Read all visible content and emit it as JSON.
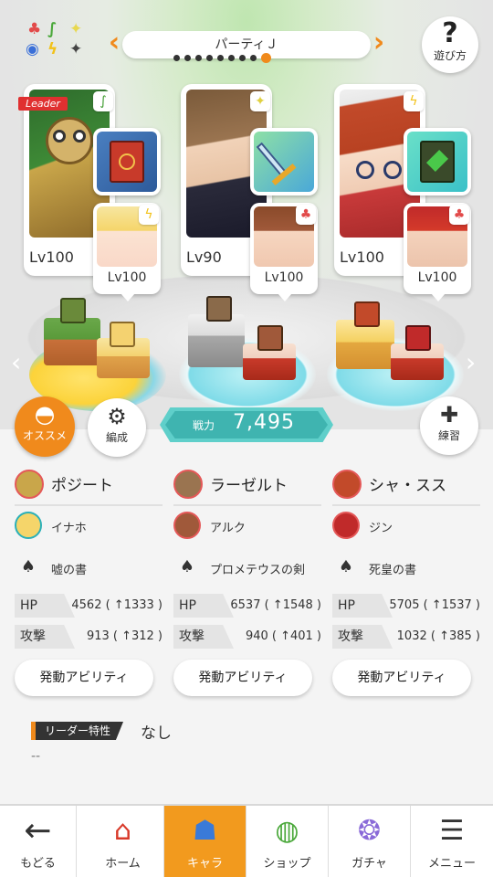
{
  "header": {
    "party_name": "パーティＪ",
    "help_label": "遊び方",
    "page_total": 9,
    "page_active": 9
  },
  "attributes_legend": [
    "fire",
    "nature",
    "light",
    "water",
    "thunder",
    "dark"
  ],
  "cards": [
    {
      "leader_tag": "Leader",
      "main_level": "Lv100",
      "sub_level": "Lv100",
      "attribute": "nature",
      "sub_attribute": "thunder"
    },
    {
      "leader_tag": "",
      "main_level": "Lv90",
      "sub_level": "Lv100",
      "attribute": "light",
      "sub_attribute": "fire"
    },
    {
      "leader_tag": "",
      "main_level": "Lv100",
      "sub_level": "Lv100",
      "attribute": "thunder",
      "sub_attribute": "fire"
    }
  ],
  "actions": {
    "recommend_label": "オススメ",
    "formation_label": "編成",
    "practice_label": "練習",
    "power_label": "戦力",
    "power_value": "7,495"
  },
  "members": [
    {
      "main_name": "ポジート",
      "sub_name": "イナホ",
      "equip_name": "嘘の書",
      "hp_label": "HP",
      "hp_value": "4562 ( ↑1333 )",
      "atk_label": "攻撃",
      "atk_value": "913 ( ↑312 )",
      "ability_label": "発動アビリティ"
    },
    {
      "main_name": "ラーゼルト",
      "sub_name": "アルク",
      "equip_name": "プロメテウスの剣",
      "hp_label": "HP",
      "hp_value": "6537 ( ↑1548 )",
      "atk_label": "攻撃",
      "atk_value": "940 ( ↑401 )",
      "ability_label": "発動アビリティ"
    },
    {
      "main_name": "シャ・スス",
      "sub_name": "ジン",
      "equip_name": "死皇の書",
      "hp_label": "HP",
      "hp_value": "5705 ( ↑1537 )",
      "atk_label": "攻撃",
      "atk_value": "1032 ( ↑385 )",
      "ability_label": "発動アビリティ"
    }
  ],
  "leader_trait": {
    "label": "リーダー特性",
    "value": "なし",
    "description": "--"
  },
  "nav": {
    "back": "もどる",
    "home": "ホーム",
    "chara": "キャラ",
    "shop": "ショップ",
    "gacha": "ガチャ",
    "menu": "メニュー",
    "active": "chara"
  },
  "colors": {
    "accent": "#f08a1c",
    "power": "#3fb4b0",
    "leader": "#e03030"
  }
}
